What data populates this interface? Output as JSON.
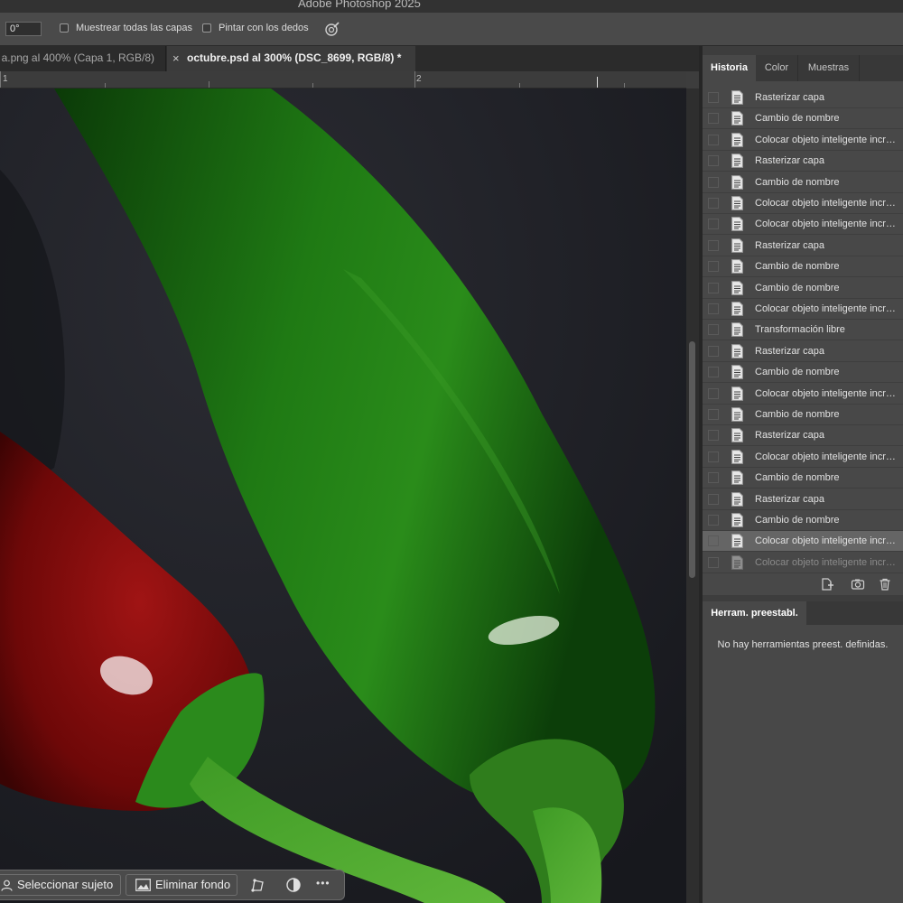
{
  "window": {
    "title": "Adobe Photoshop 2025"
  },
  "options_bar": {
    "angle_value": "0°",
    "sample_all_layers_label": "Muestrear todas las capas",
    "finger_paint_label": "Pintar con los dedos",
    "finger_icon": "smudge-finger-icon"
  },
  "doc_tabs": [
    {
      "label": "a.png al 400% (Capa 1, RGB/8)",
      "active": false
    },
    {
      "label": "octubre.psd al 300% (DSC_8699, RGB/8) *",
      "active": true,
      "close": "×"
    }
  ],
  "ruler": {
    "marks": [
      "1",
      "2"
    ]
  },
  "history_panel": {
    "tabs": [
      "Historia",
      "Color",
      "Muestras"
    ],
    "active_tab": "Historia",
    "items": [
      "Rasterizar capa",
      "Cambio de nombre",
      "Colocar objeto inteligente incrustado",
      "Rasterizar capa",
      "Cambio de nombre",
      "Colocar objeto inteligente incrustado",
      "Colocar objeto inteligente incrustado",
      "Rasterizar capa",
      "Cambio de nombre",
      "Cambio de nombre",
      "Colocar objeto inteligente incrustado",
      "Transformación libre",
      "Rasterizar capa",
      "Cambio de nombre",
      "Colocar objeto inteligente incrustado",
      "Cambio de nombre",
      "Rasterizar capa",
      "Colocar objeto inteligente incrustado",
      "Cambio de nombre",
      "Rasterizar capa",
      "Cambio de nombre",
      "Colocar objeto inteligente incrustado",
      "Colocar objeto inteligente incrustado"
    ],
    "selected_index": 21,
    "dimmed_index": 22,
    "footer_icons": [
      "new-document-from-state-icon",
      "snapshot-camera-icon",
      "trash-icon"
    ]
  },
  "preset_panel": {
    "tab": "Herram. preestabl.",
    "empty_message": "No hay herramientas preest. definidas."
  },
  "context_bar": {
    "select_subject": "Seleccionar sujeto",
    "remove_background": "Eliminar fondo",
    "icons": [
      "transform-icon",
      "adjustment-circle-icon",
      "more-icon"
    ],
    "more_label": "•••"
  },
  "colors": {
    "accent_selected_row": "#656565",
    "panel_bg": "#484848",
    "canvas_bg": "#1d1e24"
  }
}
